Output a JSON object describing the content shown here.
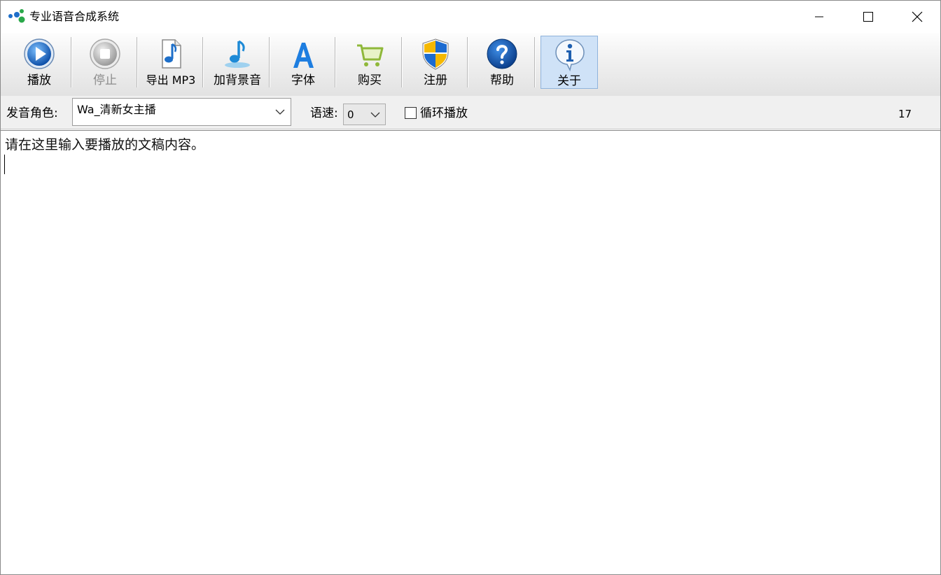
{
  "window": {
    "title": "专业语音合成系统"
  },
  "toolbar": {
    "play_label": "播放",
    "stop_label": "停止",
    "export_label": "导出 MP3",
    "bgm_label": "加背景音",
    "font_label": "字体",
    "buy_label": "购买",
    "register_label": "注册",
    "help_label": "帮助",
    "about_label": "关于"
  },
  "options": {
    "voice_label": "发音角色:",
    "voice_value": "Wa_清新女主播",
    "speed_label": "语速:",
    "speed_value": "0",
    "loop_label": "循环播放",
    "loop_checked": false,
    "char_count": "17"
  },
  "editor": {
    "text": "请在这里输入要播放的文稿内容。"
  },
  "colors": {
    "accent_blue": "#1e6fc9",
    "shield_yellow": "#f5b800",
    "active_button_bg": "#cfe2f7"
  }
}
